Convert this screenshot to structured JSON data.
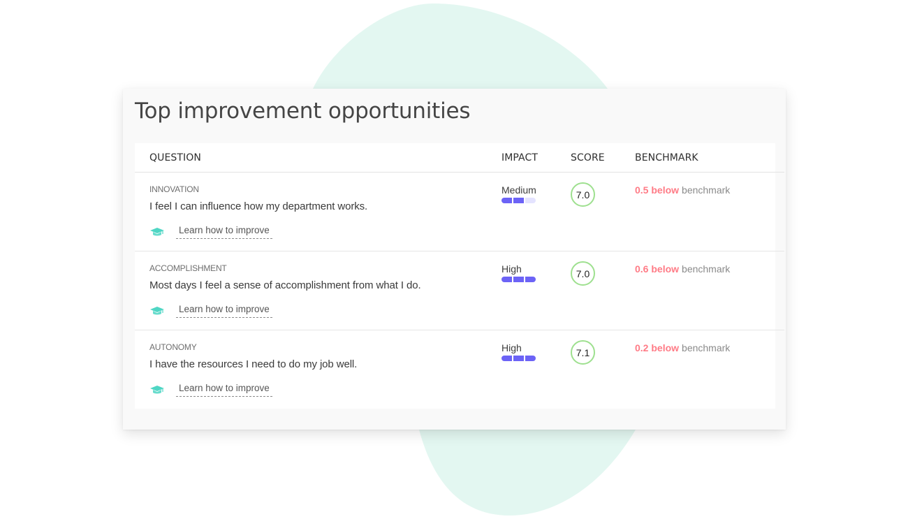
{
  "colors": {
    "blob": "#e3f7f1",
    "impact_active": "#6c63f6",
    "impact_inactive": "#e4e3ff",
    "score_ring": "#9ee08f",
    "below_benchmark": "#ff7b86",
    "learn_icon": "#4fd6c4"
  },
  "card": {
    "title": "Top improvement opportunities"
  },
  "table": {
    "headers": {
      "question": "QUESTION",
      "impact": "IMPACT",
      "score": "SCORE",
      "benchmark": "BENCHMARK"
    },
    "rows": [
      {
        "category": "INNOVATION",
        "question": "I feel I can influence how my department works.",
        "learn_label": "Learn how to improve",
        "learn_icon": "graduation-cap-icon",
        "impact_label": "Medium",
        "impact_level": 2,
        "impact_max": 3,
        "score": "7.0",
        "benchmark_delta": "0.5 below",
        "benchmark_text": "benchmark"
      },
      {
        "category": "ACCOMPLISHMENT",
        "question": "Most days I feel a sense of accomplishment from what I do.",
        "learn_label": "Learn how to improve",
        "learn_icon": "graduation-cap-icon",
        "impact_label": "High",
        "impact_level": 3,
        "impact_max": 3,
        "score": "7.0",
        "benchmark_delta": "0.6 below",
        "benchmark_text": "benchmark"
      },
      {
        "category": "AUTONOMY",
        "question": "I have the resources I need to do my job well.",
        "learn_label": "Learn how to improve",
        "learn_icon": "graduation-cap-icon",
        "impact_label": "High",
        "impact_level": 3,
        "impact_max": 3,
        "score": "7.1",
        "benchmark_delta": "0.2 below",
        "benchmark_text": "benchmark"
      }
    ]
  }
}
